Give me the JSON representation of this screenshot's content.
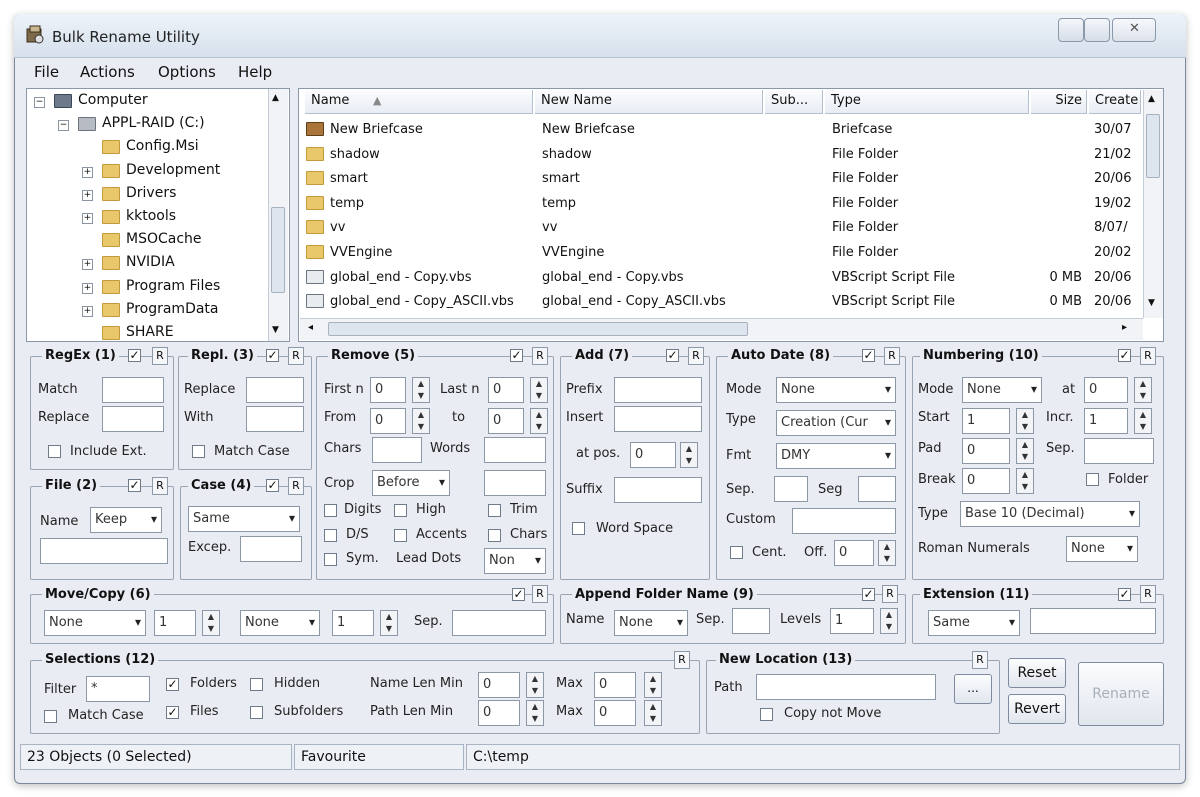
{
  "window": {
    "title": "Bulk Rename Utility"
  },
  "menu": [
    "File",
    "Actions",
    "Options",
    "Help"
  ],
  "tree": [
    {
      "label": "Computer",
      "expander": "−"
    },
    {
      "label": "APPL-RAID (C:)",
      "expander": "−"
    },
    {
      "label": "Config.Msi",
      "expander": ""
    },
    {
      "label": "Development",
      "expander": "+"
    },
    {
      "label": "Drivers",
      "expander": "+"
    },
    {
      "label": "kktools",
      "expander": "+"
    },
    {
      "label": "MSOCache",
      "expander": ""
    },
    {
      "label": "NVIDIA",
      "expander": "+"
    },
    {
      "label": "Program Files",
      "expander": "+"
    },
    {
      "label": "ProgramData",
      "expander": "+"
    },
    {
      "label": "SHARE",
      "expander": ""
    }
  ],
  "filelist": {
    "headers": {
      "name": "Name",
      "newname": "New Name",
      "sub": "Sub...",
      "type": "Type",
      "size": "Size",
      "created": "Create"
    },
    "rows": [
      {
        "name": "New Briefcase",
        "newname": "New Briefcase",
        "type": "Briefcase",
        "size": "",
        "created": "30/07"
      },
      {
        "name": "shadow",
        "newname": "shadow",
        "type": "File Folder",
        "size": "",
        "created": "21/02"
      },
      {
        "name": "smart",
        "newname": "smart",
        "type": "File Folder",
        "size": "",
        "created": "20/06"
      },
      {
        "name": "temp",
        "newname": "temp",
        "type": "File Folder",
        "size": "",
        "created": "19/02"
      },
      {
        "name": "vv",
        "newname": "vv",
        "type": "File Folder",
        "size": "",
        "created": "8/07/"
      },
      {
        "name": "VVEngine",
        "newname": "VVEngine",
        "type": "File Folder",
        "size": "",
        "created": "20/02"
      },
      {
        "name": "global_end - Copy.vbs",
        "newname": "global_end - Copy.vbs",
        "type": "VBScript Script File",
        "size": "0 MB",
        "created": "20/06"
      },
      {
        "name": "global_end - Copy_ASCII.vbs",
        "newname": "global_end - Copy_ASCII.vbs",
        "type": "VBScript Script File",
        "size": "0 MB",
        "created": "20/06"
      }
    ]
  },
  "regex": {
    "title": "RegEx (1)",
    "match": "Match",
    "replace": "Replace",
    "include_ext": "Include Ext."
  },
  "repl": {
    "title": "Repl. (3)",
    "replace": "Replace",
    "with": "With",
    "match_case": "Match Case"
  },
  "remove": {
    "title": "Remove (5)",
    "first_n": "First n",
    "first_n_val": "0",
    "last_n": "Last n",
    "last_n_val": "0",
    "from": "From",
    "from_val": "0",
    "to": "to",
    "to_val": "0",
    "chars": "Chars",
    "words": "Words",
    "crop": "Crop",
    "crop_val": "Before",
    "digits": "Digits",
    "high": "High",
    "trim": "Trim",
    "ds": "D/S",
    "accents": "Accents",
    "chars2": "Chars",
    "sym": "Sym.",
    "lead_dots": "Lead Dots",
    "lead_val": "Non"
  },
  "add": {
    "title": "Add (7)",
    "prefix": "Prefix",
    "insert": "Insert",
    "at_pos": "at pos.",
    "at_pos_val": "0",
    "suffix": "Suffix",
    "word_space": "Word Space"
  },
  "autodate": {
    "title": "Auto Date (8)",
    "mode": "Mode",
    "mode_val": "None",
    "type": "Type",
    "type_val": "Creation (Cur",
    "fmt": "Fmt",
    "fmt_val": "DMY",
    "sep": "Sep.",
    "seg": "Seg",
    "custom": "Custom",
    "cent": "Cent.",
    "off": "Off.",
    "off_val": "0"
  },
  "numbering": {
    "title": "Numbering (10)",
    "mode": "Mode",
    "mode_val": "None",
    "at": "at",
    "at_val": "0",
    "start": "Start",
    "start_val": "1",
    "incr": "Incr.",
    "incr_val": "1",
    "pad": "Pad",
    "pad_val": "0",
    "sep": "Sep.",
    "break": "Break",
    "break_val": "0",
    "folder": "Folder",
    "type": "Type",
    "type_val": "Base 10 (Decimal)",
    "roman": "Roman Numerals",
    "roman_val": "None"
  },
  "file": {
    "title": "File (2)",
    "name": "Name",
    "name_val": "Keep"
  },
  "case": {
    "title": "Case (4)",
    "case_val": "Same",
    "excep": "Excep."
  },
  "movecopy": {
    "title": "Move/Copy (6)",
    "sel1": "None",
    "num1": "1",
    "sel2": "None",
    "num2": "1",
    "sep": "Sep."
  },
  "appendfolder": {
    "title": "Append Folder Name (9)",
    "name": "Name",
    "name_val": "None",
    "sep": "Sep.",
    "levels": "Levels",
    "levels_val": "1"
  },
  "extension": {
    "title": "Extension (11)",
    "ext_val": "Same"
  },
  "selections": {
    "title": "Selections (12)",
    "filter": "Filter",
    "filter_val": "*",
    "folders": "Folders",
    "hidden": "Hidden",
    "name_len_min": "Name Len Min",
    "name_len_val": "0",
    "max": "Max",
    "max_val1": "0",
    "match_case": "Match Case",
    "files": "Files",
    "subfolders": "Subfolders",
    "path_len_min": "Path Len Min",
    "path_len_val": "0",
    "max_val2": "0"
  },
  "newlocation": {
    "title": "New Location (13)",
    "path": "Path",
    "browse": "...",
    "copy_not_move": "Copy not Move"
  },
  "buttons": {
    "reset": "Reset",
    "revert": "Revert",
    "rename": "Rename"
  },
  "status": {
    "objects": "23 Objects (0 Selected)",
    "favourite": "Favourite",
    "path": "C:\\temp"
  },
  "r_label": "R",
  "check_mark": "✓"
}
